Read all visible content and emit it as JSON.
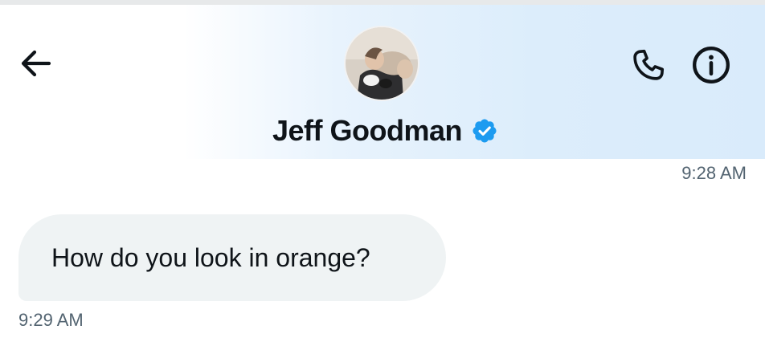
{
  "header": {
    "contact_name": "Jeff Goodman",
    "verified": true,
    "back_icon": "arrow-left-icon",
    "call_icon": "phone-icon",
    "info_icon": "info-icon",
    "accent_color": "#1d9bf0"
  },
  "messages": [
    {
      "type": "timestamp",
      "align": "right",
      "text": "9:28 AM"
    },
    {
      "type": "incoming",
      "text": "How do you look in orange?",
      "time": "9:29 AM"
    }
  ]
}
